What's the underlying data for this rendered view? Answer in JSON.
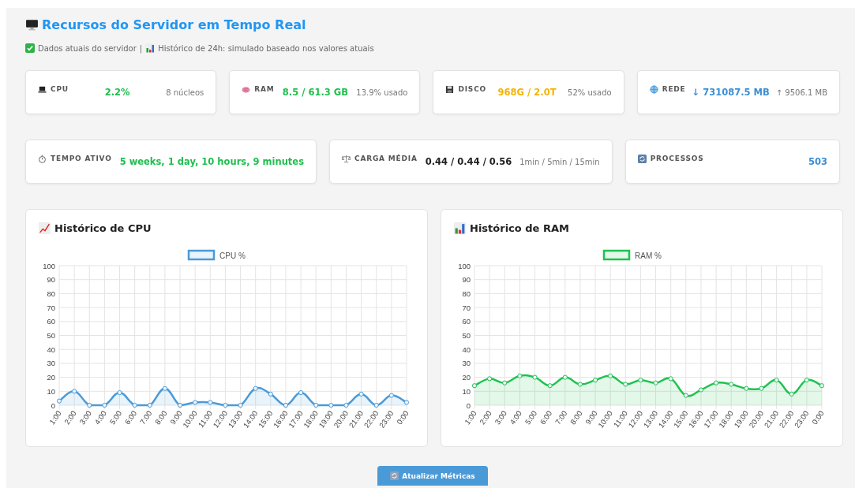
{
  "header": {
    "title": "Recursos do Servidor em Tempo Real",
    "status": "Dados atuais do servidor",
    "separator": "|",
    "note": "Histórico de 24h: simulado baseado nos valores atuais"
  },
  "summary_row_1": [
    {
      "kind": "cpu",
      "label": "CPU",
      "value": "2.2%",
      "color": "#1fbf4f",
      "detail": "8 núcleos"
    },
    {
      "kind": "ram",
      "label": "RAM",
      "value": "8.5 / 61.3 GB",
      "color": "#1fbf4f",
      "detail": "13.9% usado"
    },
    {
      "kind": "disk",
      "label": "DISCO",
      "value": "968G / 2.0T",
      "color": "#f5b300",
      "detail": "52% usado"
    },
    {
      "kind": "network",
      "label": "REDE",
      "value": "↓ 731087.5 MB",
      "color": "#3a8fd6",
      "detail": "↑ 9506.1 MB"
    }
  ],
  "summary_row_2": [
    {
      "kind": "uptime",
      "label": "TEMPO ATIVO",
      "value": "5 weeks, 1 day, 10 hours, 9 minutes",
      "color": "#1fbf4f"
    },
    {
      "kind": "load",
      "label": "CARGA MÉDIA",
      "value": "0.44 / 0.44 / 0.56",
      "color": "#222222",
      "detail": "1min / 5min / 15min"
    },
    {
      "kind": "processes",
      "label": "PROCESSOS",
      "value": "503",
      "color": "#3a8fd6"
    }
  ],
  "charts": [
    {
      "kind": "trend",
      "title": "Histórico de CPU",
      "chart_data": {
        "type": "line",
        "grid": true,
        "categories": [
          "1:00",
          "2:00",
          "3:00",
          "4:00",
          "5:00",
          "6:00",
          "7:00",
          "8:00",
          "9:00",
          "10:00",
          "11:00",
          "12:00",
          "13:00",
          "14:00",
          "15:00",
          "16:00",
          "17:00",
          "18:00",
          "19:00",
          "20:00",
          "21:00",
          "22:00",
          "23:00",
          "0:00"
        ],
        "ylim": [
          0,
          100
        ],
        "yticks": [
          0,
          10,
          20,
          30,
          40,
          50,
          60,
          70,
          80,
          90,
          100
        ],
        "series": [
          {
            "name": "CPU %",
            "color": "#4a9ad8",
            "marker": true,
            "values": [
              3,
              10,
              0,
              0,
              9,
              0,
              0,
              12,
              0,
              2,
              2,
              0,
              0,
              12,
              8,
              0,
              9,
              0,
              0,
              0,
              8,
              0,
              7,
              2
            ]
          }
        ]
      }
    },
    {
      "kind": "bars",
      "title": "Histórico de RAM",
      "chart_data": {
        "type": "line",
        "grid": true,
        "categories": [
          "1:00",
          "2:00",
          "3:00",
          "4:00",
          "5:00",
          "6:00",
          "7:00",
          "8:00",
          "9:00",
          "10:00",
          "11:00",
          "12:00",
          "13:00",
          "14:00",
          "15:00",
          "16:00",
          "17:00",
          "18:00",
          "19:00",
          "20:00",
          "21:00",
          "22:00",
          "23:00",
          "0:00"
        ],
        "ylim": [
          0,
          100
        ],
        "yticks": [
          0,
          10,
          20,
          30,
          40,
          50,
          60,
          70,
          80,
          90,
          100
        ],
        "series": [
          {
            "name": "RAM %",
            "color": "#1fc24f",
            "marker": true,
            "values": [
              14,
              19,
              16,
              21,
              20,
              14,
              20,
              15,
              18,
              21,
              15,
              18,
              16,
              19,
              7,
              11,
              16,
              15,
              12,
              12,
              18,
              8,
              18,
              14
            ]
          }
        ]
      }
    }
  ],
  "button": {
    "label": "Atualizar Métricas"
  }
}
